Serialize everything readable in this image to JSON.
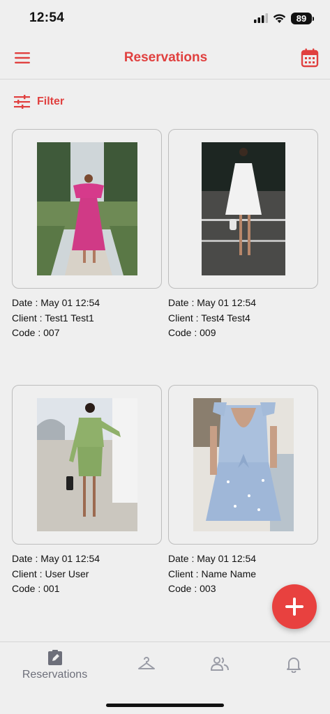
{
  "status_bar": {
    "time": "12:54",
    "battery": "89",
    "icons": [
      "cellular-signal-icon",
      "wifi-icon",
      "battery-icon"
    ]
  },
  "header": {
    "title": "Reservations",
    "menu_icon": "hamburger-menu-icon",
    "calendar_icon": "calendar-icon"
  },
  "filter": {
    "label": "Filter",
    "icon": "sliders-icon"
  },
  "reservations": [
    {
      "date": "Date : May 01 12:54",
      "client": "Client : Test1 Test1",
      "code": "Code : 007",
      "photo": "pink-dress"
    },
    {
      "date": "Date : May 01 12:54",
      "client": "Client : Test4 Test4",
      "code": "Code : 009",
      "photo": "white-dress"
    },
    {
      "date": "Date : May 01 12:54",
      "client": "Client : User User",
      "code": "Code : 001",
      "photo": "green-dress"
    },
    {
      "date": "Date : May 01 12:54",
      "client": "Client : Name Name",
      "code": "Code : 003",
      "photo": "blue-floral-dress"
    }
  ],
  "fab": {
    "icon": "plus-icon"
  },
  "bottom_nav": {
    "items": [
      {
        "label": "Reservations",
        "icon": "clipboard-edit-icon",
        "active": true
      },
      {
        "label": "",
        "icon": "hanger-icon",
        "active": false
      },
      {
        "label": "",
        "icon": "users-icon",
        "active": false
      },
      {
        "label": "",
        "icon": "bell-icon",
        "active": false
      }
    ]
  },
  "colors": {
    "accent": "#e0403f",
    "background": "#efefef",
    "inactive": "#9a9ca6"
  }
}
